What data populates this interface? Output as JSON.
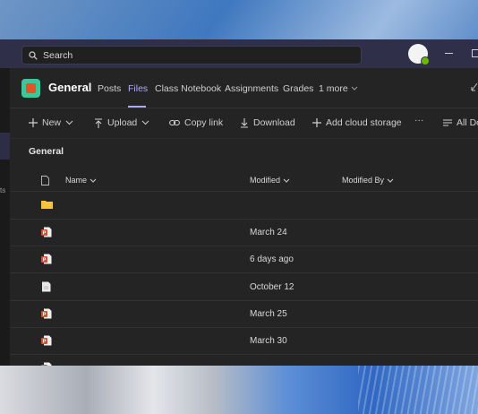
{
  "search": {
    "placeholder": "Search"
  },
  "channel": {
    "title": "General",
    "tabs": [
      "Posts",
      "Files",
      "Class Notebook",
      "Assignments",
      "Grades",
      "1 more"
    ],
    "active_tab": "Files"
  },
  "toolbar": {
    "new_label": "New",
    "upload_label": "Upload",
    "copy_link_label": "Copy link",
    "download_label": "Download",
    "more_label": "···",
    "add_cloud_label": "Add cloud storage",
    "all_docs_label": "All Do"
  },
  "breadcrumb": "General",
  "rail": {
    "frag1": "ts"
  },
  "table": {
    "headers": {
      "name": "Name",
      "modified": "Modified",
      "modified_by": "Modified By"
    },
    "rows": [
      {
        "type": "folder",
        "modified": ""
      },
      {
        "type": "ppt",
        "modified": "March 24"
      },
      {
        "type": "ppt",
        "modified": "6 days ago"
      },
      {
        "type": "doc",
        "modified": "October 12"
      },
      {
        "type": "ppt",
        "modified": "March 25"
      },
      {
        "type": "ppt",
        "modified": "March 30"
      },
      {
        "type": "ppt",
        "modified": ""
      }
    ]
  },
  "colors": {
    "accent": "#a9acf5",
    "titlebar": "#2f2f4a",
    "ppt": "#d35230",
    "folder": "#f5c342",
    "presence": "#6bb700"
  }
}
